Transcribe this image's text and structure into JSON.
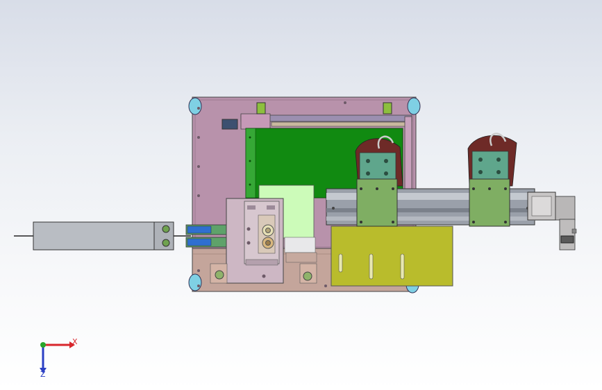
{
  "view": {
    "background_top": "#d8dde8",
    "background_bottom": "#ffffff"
  },
  "triad": {
    "x_label": "X",
    "z_label": "Z",
    "x_color": "#d8262c",
    "y_color": "#2aa52a",
    "z_color": "#2b3fc4"
  },
  "colors": {
    "frame_plate": "#b892ab",
    "base_plate": "#c4a59b",
    "pcb_green": "#118a11",
    "linear_rail": "#9aa0aa",
    "carriage_green": "#7fae63",
    "head_teal": "#5fa68c",
    "yellow_plate": "#b9bc2c",
    "cylinder_body": "#b9bdc3",
    "light_panel": "#ccfbb9",
    "stop_block": "#c8c6c6"
  }
}
